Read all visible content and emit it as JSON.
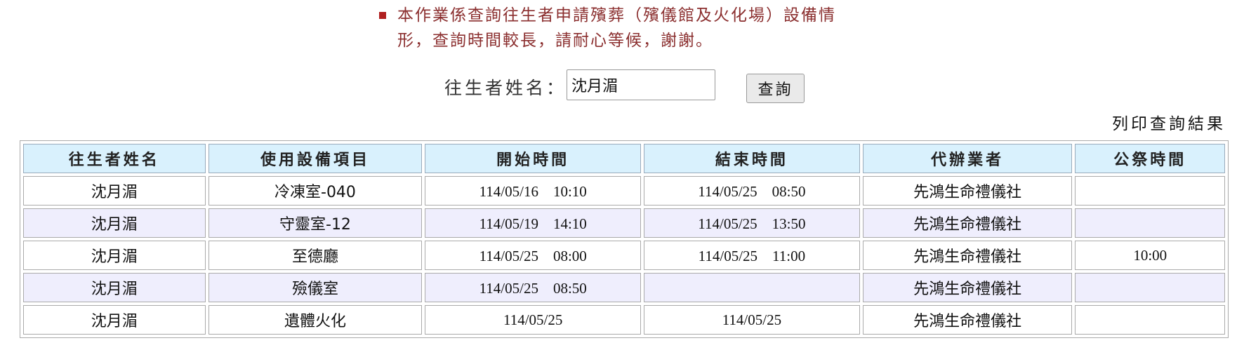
{
  "notice": {
    "line1": "本作業係查詢往生者申請殯葬（殯儀館及火化場）設備情",
    "line2": "形，查詢時間較長，請耐心等候，謝謝。"
  },
  "search": {
    "label": "往生者姓名：",
    "value": "沈月湄",
    "button_label": "查詢"
  },
  "print_label": "列印查詢結果",
  "table": {
    "headers": [
      "往生者姓名",
      "使用設備項目",
      "開始時間",
      "結束時間",
      "代辦業者",
      "公祭時間"
    ],
    "rows": [
      {
        "name": "沈月湄",
        "item": "冷凍室-040",
        "start": "114/05/16　10:10",
        "end": "114/05/25　08:50",
        "agent": "先鴻生命禮儀社",
        "ceremony": ""
      },
      {
        "name": "沈月湄",
        "item": "守靈室-12",
        "start": "114/05/19　14:10",
        "end": "114/05/25　13:50",
        "agent": "先鴻生命禮儀社",
        "ceremony": ""
      },
      {
        "name": "沈月湄",
        "item": "至德廳",
        "start": "114/05/25　08:00",
        "end": "114/05/25　11:00",
        "agent": "先鴻生命禮儀社",
        "ceremony": "10:00"
      },
      {
        "name": "沈月湄",
        "item": "殮儀室",
        "start": "114/05/25　08:50",
        "end": "",
        "agent": "先鴻生命禮儀社",
        "ceremony": ""
      },
      {
        "name": "沈月湄",
        "item": "遺體火化",
        "start": "114/05/25",
        "end": "114/05/25",
        "agent": "先鴻生命禮儀社",
        "ceremony": ""
      }
    ]
  }
}
